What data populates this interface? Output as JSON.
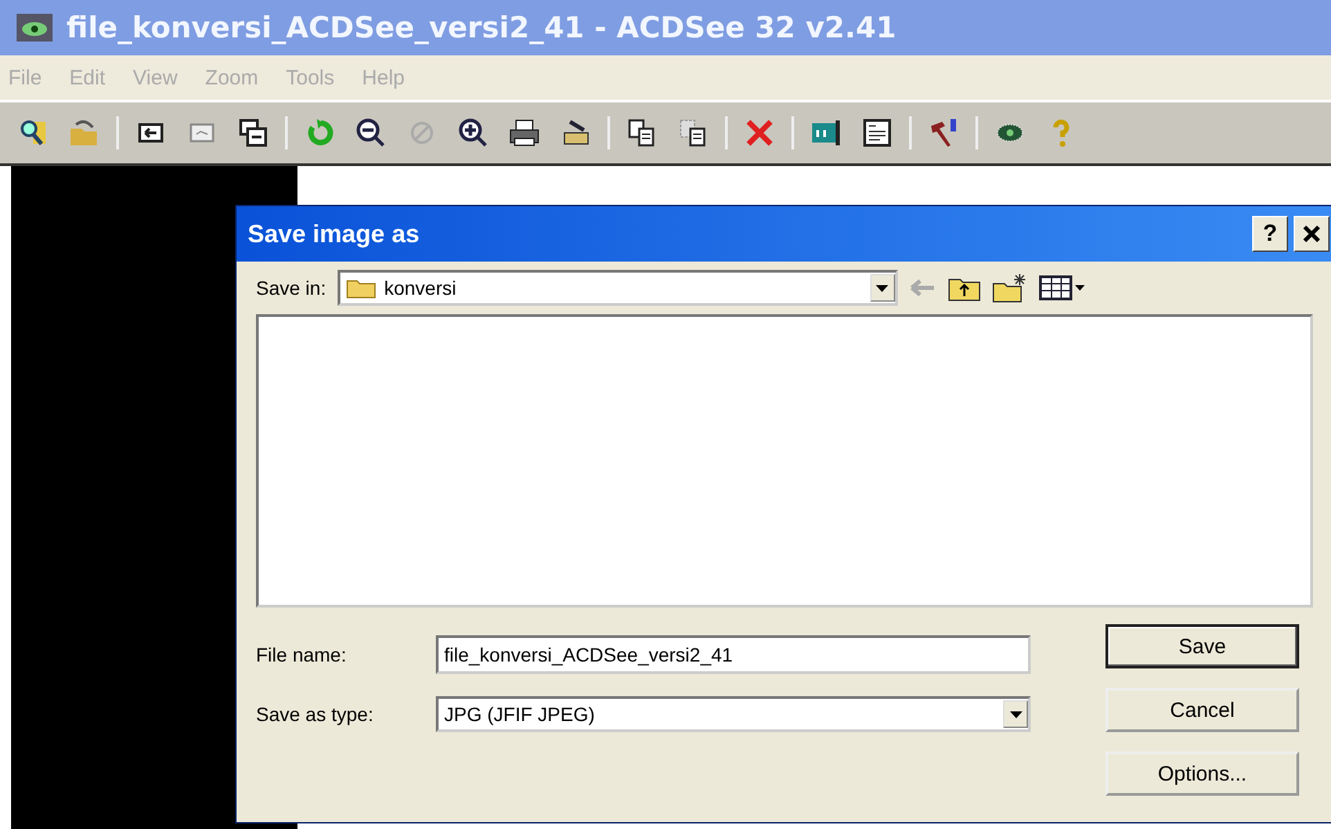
{
  "window": {
    "title": "file_konversi_ACDSee_versi2_41 - ACDSee 32 v2.41"
  },
  "menu": [
    "File",
    "Edit",
    "View",
    "Zoom",
    "Tools",
    "Help"
  ],
  "dialog": {
    "title": "Save image as",
    "help_button": "?",
    "save_in": {
      "label": "Save in:",
      "value": "konversi"
    },
    "file_name": {
      "label": "File name:",
      "value": "file_konversi_ACDSee_versi2_41"
    },
    "save_as_type": {
      "label": "Save as type:",
      "value": "JPG (JFIF JPEG)"
    },
    "buttons": [
      {
        "label": "Save",
        "default": true
      },
      {
        "label": "Cancel",
        "default": false
      },
      {
        "label": "Options...",
        "default": false
      }
    ]
  }
}
